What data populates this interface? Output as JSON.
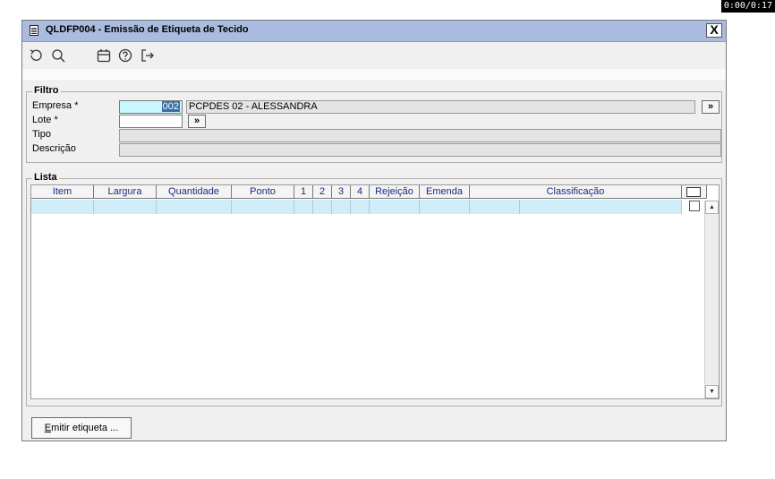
{
  "timer": "0:00/0:17",
  "window": {
    "title": "QLDFP004 - Emissão de Etiqueta de Tecido",
    "close_label": "X"
  },
  "toolbar": {
    "icons": [
      "refresh-icon",
      "search-icon",
      "calendar-icon",
      "help-icon",
      "exit-icon"
    ]
  },
  "filtro": {
    "legend": "Filtro",
    "empresa_label": "Empresa *",
    "empresa_code": "002",
    "empresa_name": "PCPDES 02 - ALESSANDRA",
    "lote_label": "Lote *",
    "lote_value": "",
    "tipo_label": "Tipo",
    "tipo_value": "",
    "descricao_label": "Descrição",
    "descricao_value": "",
    "lookup_button": "»"
  },
  "lista": {
    "legend": "Lista",
    "columns": [
      "Item",
      "Largura",
      "Quantidade",
      "Ponto",
      "1",
      "2",
      "3",
      "4",
      "Rejeição",
      "Emenda",
      "Classificação"
    ],
    "rows": [
      {
        "item": "",
        "largura": "",
        "quantidade": "",
        "ponto": "",
        "c1": "",
        "c2": "",
        "c3": "",
        "c4": "",
        "rejeicao": "",
        "emenda": "",
        "classificacao": "",
        "checked": false
      }
    ]
  },
  "footer": {
    "emit_button": "Emitir etiqueta ...",
    "emit_mnemonic": "E"
  },
  "colors": {
    "titlebar": "#a9bcdf",
    "selected_row": "#cfeefa",
    "highlight_field": "#c8f8ff",
    "header_text": "#1a2a80"
  }
}
